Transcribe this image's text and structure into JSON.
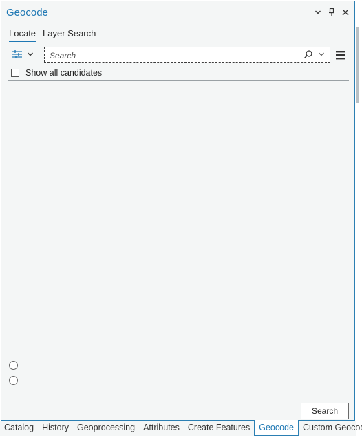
{
  "pane": {
    "title": "Geocode",
    "title_icons": [
      "chevron-down-icon",
      "pin-icon",
      "close-icon"
    ]
  },
  "tabs": [
    {
      "label": "Locate",
      "active": true
    },
    {
      "label": "Layer Search",
      "active": false
    }
  ],
  "search": {
    "placeholder": "Search",
    "value": ""
  },
  "options": {
    "show_all_candidates_label": "Show all candidates",
    "show_all_candidates_checked": false
  },
  "search_button_label": "Search",
  "bottom_tabs": [
    {
      "label": "Catalog",
      "active": false
    },
    {
      "label": "History",
      "active": false
    },
    {
      "label": "Geoprocessing",
      "active": false
    },
    {
      "label": "Attributes",
      "active": false
    },
    {
      "label": "Create Features",
      "active": false
    },
    {
      "label": "Geocode",
      "active": true
    },
    {
      "label": "Custom Geocode",
      "active": false
    }
  ],
  "colors": {
    "accent": "#1f78b4",
    "pane_background": "#f4f6f6"
  }
}
